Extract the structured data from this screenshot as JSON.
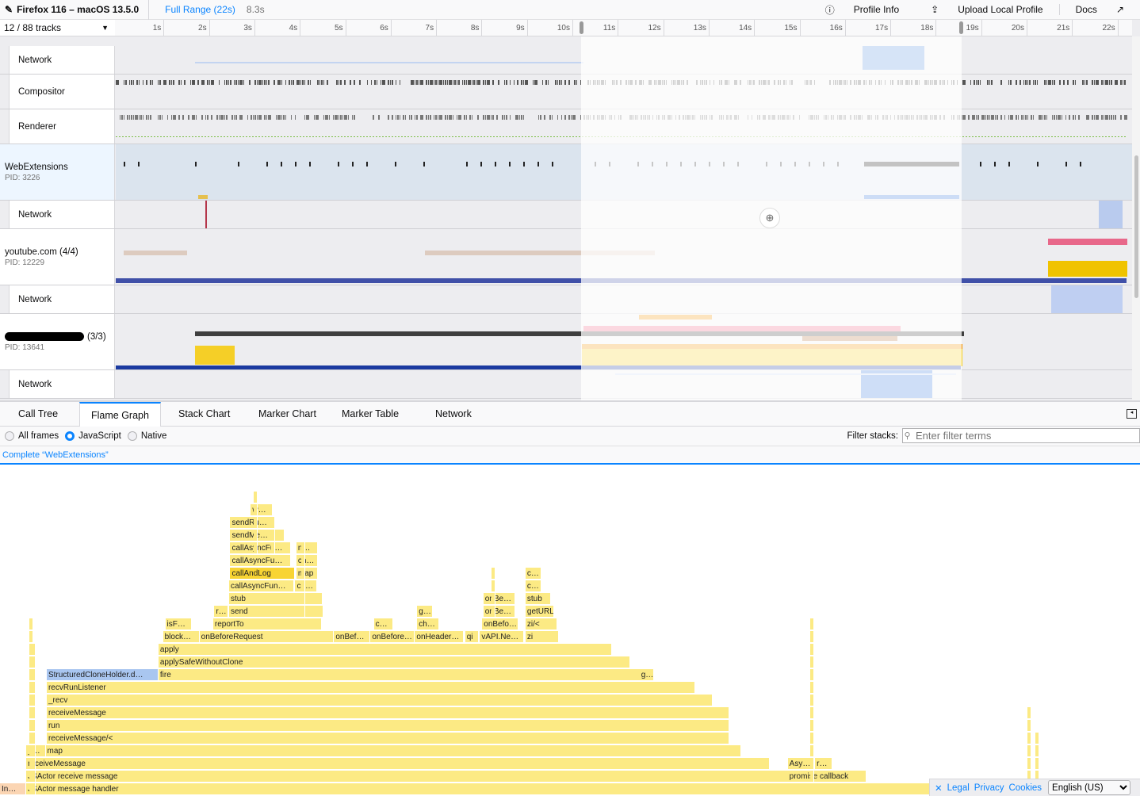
{
  "topbar": {
    "title": "Firefox 116 – macOS 13.5.0",
    "range": "Full Range (22s)",
    "preview_duration": "8.3s",
    "profile_info": "Profile Info",
    "upload": "Upload Local Profile",
    "docs": "Docs"
  },
  "tracks_header": {
    "count_visible": "12",
    "count_total": "88",
    "label": "tracks",
    "text": "12 / 88 tracks"
  },
  "ruler": {
    "ticks": [
      "1s",
      "2s",
      "3s",
      "4s",
      "5s",
      "6s",
      "7s",
      "8s",
      "9s",
      "10s",
      "11s",
      "12s",
      "13s",
      "14s",
      "15s",
      "16s",
      "17s",
      "18s",
      "19s",
      "20s",
      "21s",
      "22s"
    ],
    "selection_start_s": 10.3,
    "selection_end_s": 18.6
  },
  "tracks": [
    {
      "name": "Network",
      "type": "child"
    },
    {
      "name": "Compositor",
      "type": "child"
    },
    {
      "name": "Renderer",
      "type": "child"
    },
    {
      "name": "WebExtensions",
      "pid": "PID: 3226",
      "type": "process",
      "selected": true
    },
    {
      "name": "Network",
      "type": "child"
    },
    {
      "name": "youtube.com (4/4)",
      "pid": "PID: 12229",
      "type": "process"
    },
    {
      "name": "Network",
      "type": "child"
    },
    {
      "name": "(3/3)",
      "pid": "PID: 13641",
      "type": "process",
      "redacted": true
    },
    {
      "name": "Network",
      "type": "child"
    }
  ],
  "tabs": [
    "Call Tree",
    "Flame Graph",
    "Stack Chart",
    "Marker Chart",
    "Marker Table",
    "Network"
  ],
  "active_tab": "Flame Graph",
  "settings": {
    "radios": [
      {
        "label": "All frames",
        "checked": false
      },
      {
        "label": "JavaScript",
        "checked": true
      },
      {
        "label": "Native",
        "checked": false
      }
    ],
    "filter_label": "Filter stacks:",
    "filter_placeholder": "Enter filter terms"
  },
  "breadcrumb": "Complete “WebExtensions”",
  "flame_frames": [
    {
      "label": "JSActor message handler",
      "depth": 0,
      "start": 0.023,
      "end": 0.82
    },
    {
      "label": "In…",
      "depth": 0,
      "start": 0.0,
      "end": 0.023,
      "color": "orange"
    },
    {
      "label": "JSActor receive message",
      "depth": 1,
      "start": 0.023,
      "end": 0.76
    },
    {
      "label": "receiveMessage",
      "depth": 2,
      "start": 0.023,
      "end": 0.675
    },
    {
      "label": "promise callback",
      "depth": 1,
      "start": 0.691,
      "end": 0.76
    },
    {
      "label": "_…",
      "depth": 3,
      "start": 0.023,
      "end": 0.04
    },
    {
      "label": "map",
      "depth": 3,
      "start": 0.04,
      "end": 0.65
    },
    {
      "label": "Asy…",
      "depth": 2,
      "start": 0.691,
      "end": 0.714
    },
    {
      "label": "r…",
      "depth": 2,
      "start": 0.715,
      "end": 0.73
    },
    {
      "label": "receiveMessage/<",
      "depth": 4,
      "start": 0.041,
      "end": 0.64
    },
    {
      "label": "run",
      "depth": 5,
      "start": 0.041,
      "end": 0.64
    },
    {
      "label": "receiveMessage",
      "depth": 6,
      "start": 0.041,
      "end": 0.64
    },
    {
      "label": "_recv",
      "depth": 7,
      "start": 0.041,
      "end": 0.625
    },
    {
      "label": "recvRunListener",
      "depth": 8,
      "start": 0.041,
      "end": 0.61
    },
    {
      "label": "StructuredCloneHolder.d…",
      "depth": 9,
      "start": 0.041,
      "end": 0.139,
      "color": "blue"
    },
    {
      "label": "fire",
      "depth": 9,
      "start": 0.139,
      "end": 0.573
    },
    {
      "label": "g…",
      "depth": 9,
      "start": 0.561,
      "end": 0.574
    },
    {
      "label": "applySafeWithoutClone",
      "depth": 10,
      "start": 0.139,
      "end": 0.553
    },
    {
      "label": "apply",
      "depth": 11,
      "start": 0.139,
      "end": 0.537
    },
    {
      "label": "block…",
      "depth": 12,
      "start": 0.143,
      "end": 0.175
    },
    {
      "label": "onBeforeRequest",
      "depth": 12,
      "start": 0.175,
      "end": 0.293
    },
    {
      "label": "onBef…",
      "depth": 12,
      "start": 0.293,
      "end": 0.325
    },
    {
      "label": "onBefore…",
      "depth": 12,
      "start": 0.325,
      "end": 0.364
    },
    {
      "label": "onHeader…",
      "depth": 12,
      "start": 0.364,
      "end": 0.407
    },
    {
      "label": "qi",
      "depth": 12,
      "start": 0.408,
      "end": 0.42
    },
    {
      "label": "vAPI.Ne…",
      "depth": 12,
      "start": 0.421,
      "end": 0.46
    },
    {
      "label": "zi",
      "depth": 12,
      "start": 0.461,
      "end": 0.49
    },
    {
      "label": "isF…",
      "depth": 13,
      "start": 0.145,
      "end": 0.168
    },
    {
      "label": "reportTo",
      "depth": 13,
      "start": 0.187,
      "end": 0.282
    },
    {
      "label": "c…",
      "depth": 13,
      "start": 0.328,
      "end": 0.345
    },
    {
      "label": "ch…",
      "depth": 13,
      "start": 0.366,
      "end": 0.385
    },
    {
      "label": "onBefo…",
      "depth": 13,
      "start": 0.423,
      "end": 0.455
    },
    {
      "label": "zi/<",
      "depth": 13,
      "start": 0.461,
      "end": 0.489
    },
    {
      "label": "r…",
      "depth": 14,
      "start": 0.188,
      "end": 0.2
    },
    {
      "label": "send",
      "depth": 14,
      "start": 0.201,
      "end": 0.284
    },
    {
      "label": "g…",
      "depth": 14,
      "start": 0.366,
      "end": 0.38
    },
    {
      "label": "onBe…",
      "depth": 14,
      "start": 0.424,
      "end": 0.452
    },
    {
      "label": "getURL",
      "depth": 14,
      "start": 0.461,
      "end": 0.486
    },
    {
      "label": "stub",
      "depth": 15,
      "start": 0.201,
      "end": 0.283
    },
    {
      "label": "onBe…",
      "depth": 15,
      "start": 0.424,
      "end": 0.452
    },
    {
      "label": "stub",
      "depth": 15,
      "start": 0.461,
      "end": 0.483
    },
    {
      "label": "callAsyncFun…",
      "depth": 16,
      "start": 0.201,
      "end": 0.258
    },
    {
      "label": "ch…",
      "depth": 16,
      "start": 0.259,
      "end": 0.278
    },
    {
      "label": "c…",
      "depth": 16,
      "start": 0.461,
      "end": 0.475
    },
    {
      "label": "callAndLog",
      "depth": 17,
      "start": 0.202,
      "end": 0.259,
      "color": "selected"
    },
    {
      "label": "map",
      "depth": 17,
      "start": 0.26,
      "end": 0.279
    },
    {
      "label": "c…",
      "depth": 17,
      "start": 0.461,
      "end": 0.475
    },
    {
      "label": "callAsyncFu…",
      "depth": 18,
      "start": 0.202,
      "end": 0.255
    },
    {
      "label": "ch…",
      "depth": 18,
      "start": 0.26,
      "end": 0.279
    },
    {
      "label": "callAsyncFu…",
      "depth": 19,
      "start": 0.202,
      "end": 0.255
    },
    {
      "label": "n…",
      "depth": 19,
      "start": 0.26,
      "end": 0.279
    },
    {
      "label": "sendMe…",
      "depth": 20,
      "start": 0.202,
      "end": 0.25
    },
    {
      "label": "sendRu…",
      "depth": 21,
      "start": 0.202,
      "end": 0.24
    },
    {
      "label": "w…",
      "depth": 22,
      "start": 0.22,
      "end": 0.239
    }
  ],
  "footer": {
    "legal": "Legal",
    "privacy": "Privacy",
    "cookies": "Cookies",
    "language": "English (US)"
  },
  "colors": {
    "accent": "#0a84ff",
    "js_frame": "#fcea84",
    "selected_frame": "#f8d433",
    "blue_frame": "#a9c6f0"
  }
}
